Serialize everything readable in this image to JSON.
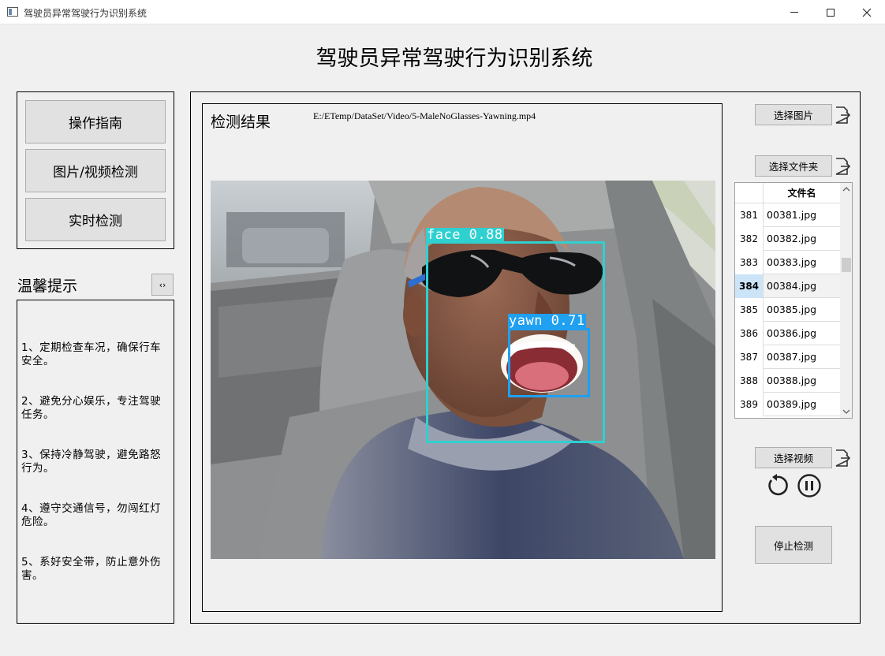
{
  "window": {
    "title": "驾驶员异常驾驶行为识别系统"
  },
  "header": {
    "title": "驾驶员异常驾驶行为识别系统"
  },
  "nav": {
    "guide": "操作指南",
    "image_video": "图片/视频检测",
    "realtime": "实时检测"
  },
  "tips": {
    "title": "温馨提示",
    "toggle": "‹›",
    "items": [
      "1、定期检查车况，确保行车安全。",
      "2、避免分心娱乐，专注驾驶任务。",
      "3、保持冷静驾驶，避免路怒行为。",
      "4、遵守交通信号，勿闯红灯危险。",
      "5、系好安全带，防止意外伤害。"
    ]
  },
  "result": {
    "label": "检测结果",
    "path": "E:/ETemp/DataSet/Video/5-MaleNoGlasses-Yawning.mp4",
    "detections": [
      {
        "label": "face 0.88",
        "color": "#2fd0d0"
      },
      {
        "label": "yawn 0.71",
        "color": "#1fa0f0"
      }
    ]
  },
  "controls": {
    "select_image": "选择图片",
    "select_folder": "选择文件夹",
    "select_video": "选择视频",
    "stop": "停止检测",
    "replay_icon": "replay-icon",
    "pause_icon": "pause-icon",
    "export_icon": "export-icon"
  },
  "file_table": {
    "header": "文件名",
    "rows": [
      {
        "idx": "381",
        "name": "00381.jpg"
      },
      {
        "idx": "382",
        "name": "00382.jpg"
      },
      {
        "idx": "383",
        "name": "00383.jpg"
      },
      {
        "idx": "384",
        "name": "00384.jpg"
      },
      {
        "idx": "385",
        "name": "00385.jpg"
      },
      {
        "idx": "386",
        "name": "00386.jpg"
      },
      {
        "idx": "387",
        "name": "00387.jpg"
      },
      {
        "idx": "388",
        "name": "00388.jpg"
      },
      {
        "idx": "389",
        "name": "00389.jpg"
      }
    ],
    "selected_idx": "384"
  }
}
